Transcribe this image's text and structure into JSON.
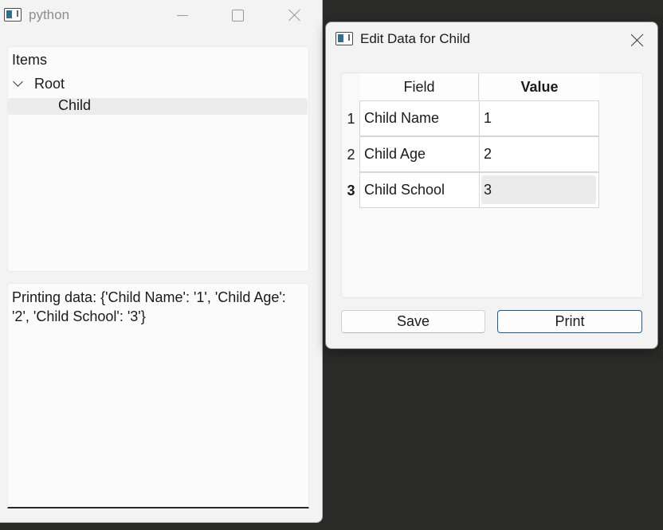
{
  "main_window": {
    "title": "python",
    "tree": {
      "header": "Items",
      "root_label": "Root",
      "child_label": "Child"
    },
    "output_text": "Printing data: {'Child Name': '1', 'Child Age': '2', 'Child School': '3'}"
  },
  "dialog": {
    "title": "Edit Data for Child",
    "table": {
      "headers": [
        "Field",
        "Value"
      ],
      "rows": [
        {
          "num": "1",
          "field": "Child Name",
          "value": "1"
        },
        {
          "num": "2",
          "field": "Child Age",
          "value": "2"
        },
        {
          "num": "3",
          "field": "Child School",
          "value": "3"
        }
      ]
    },
    "buttons": {
      "save": "Save",
      "print": "Print"
    }
  },
  "icons": [
    "app-icon",
    "minimize-icon",
    "maximize-icon",
    "close-icon",
    "chevron-down-icon"
  ]
}
